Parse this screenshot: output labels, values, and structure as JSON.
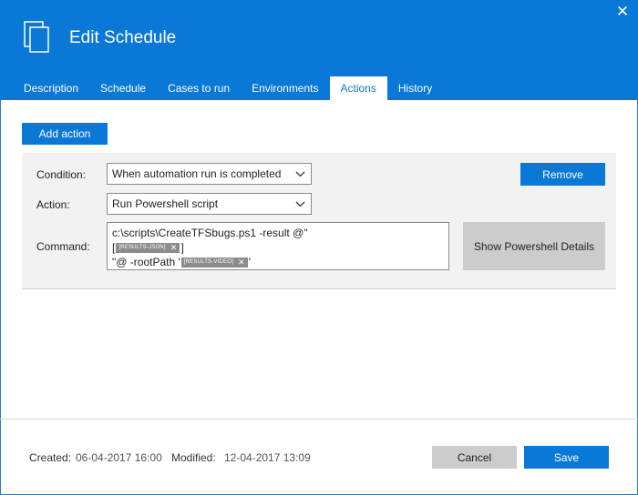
{
  "window": {
    "title": "Edit Schedule",
    "accent_color": "#0a78d7",
    "close_icon": "close-icon",
    "app_icon": "pages-icon"
  },
  "tabs": [
    {
      "label": "Description",
      "active": false
    },
    {
      "label": "Schedule",
      "active": false
    },
    {
      "label": "Cases to run",
      "active": false
    },
    {
      "label": "Environments",
      "active": false
    },
    {
      "label": "Actions",
      "active": true
    },
    {
      "label": "History",
      "active": false
    }
  ],
  "toolbar": {
    "add_action_label": "Add action"
  },
  "action": {
    "condition_label": "Condition:",
    "condition_value": "When automation run is completed",
    "action_label": "Action:",
    "action_value": "Run Powershell script",
    "command_label": "Command:",
    "command": {
      "line1": "c:\\scripts\\CreateTFSbugs.ps1 -result @\"",
      "line2_prefix": "[",
      "token1": "[RESULTS-JSON]",
      "line2_suffix": "]",
      "line3_prefix": "\"@ -rootPath '",
      "token2": "[RESULTS-VIDEO]",
      "line3_suffix": "'"
    },
    "remove_label": "Remove",
    "show_details_label": "Show Powershell Details"
  },
  "footer": {
    "created_label": "Created:",
    "created_value": "06-04-2017 16:00",
    "modified_label": "Modified:",
    "modified_value": "12-04-2017 13:09",
    "cancel_label": "Cancel",
    "save_label": "Save"
  }
}
